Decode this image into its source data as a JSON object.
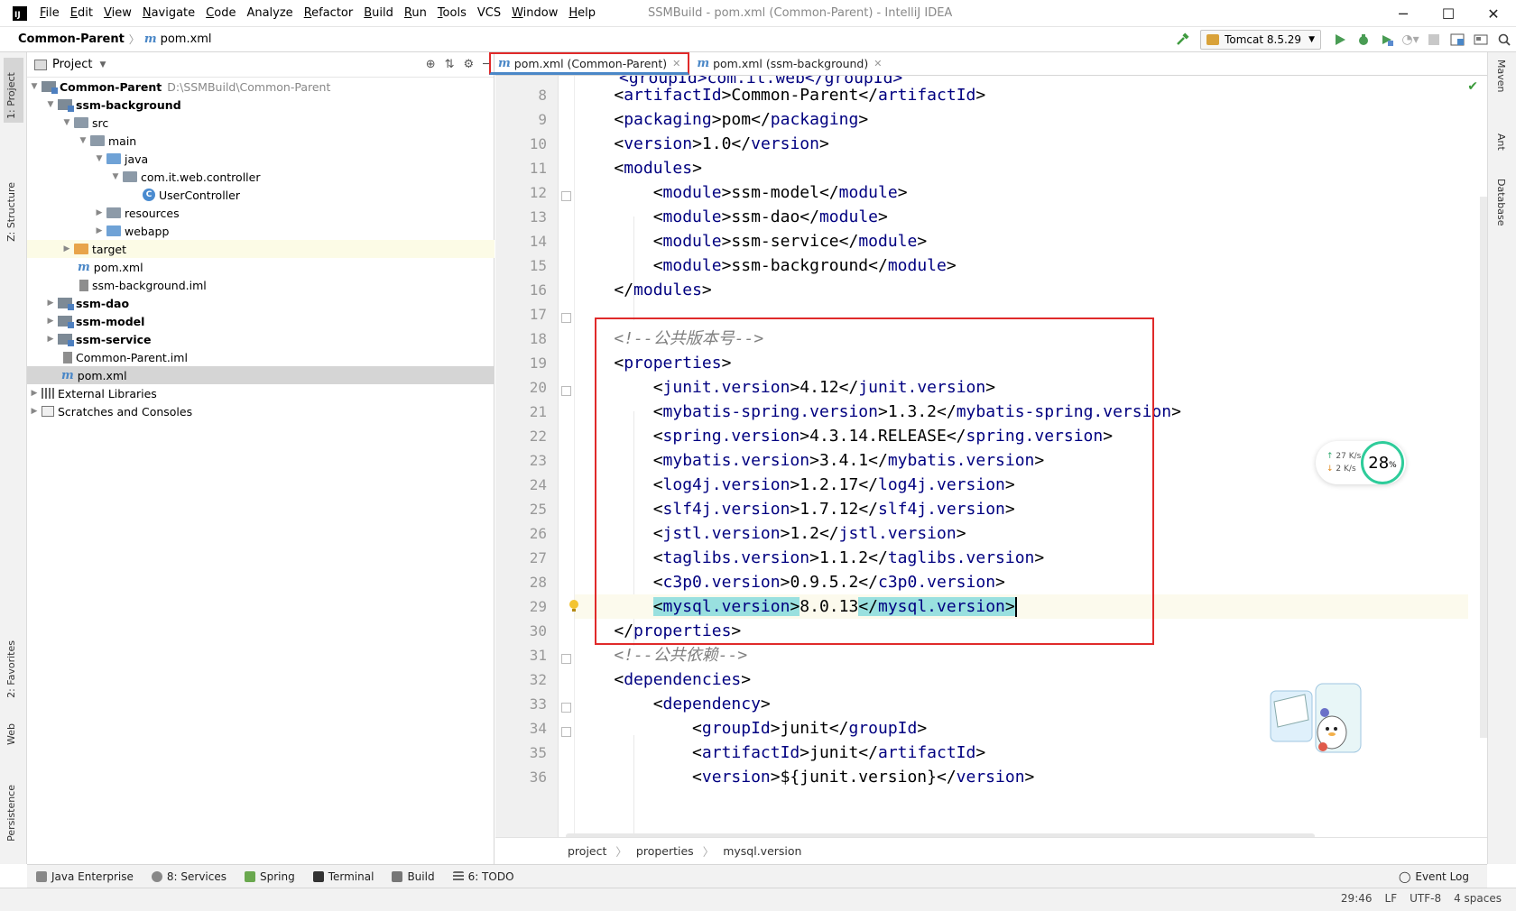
{
  "app": {
    "logo": "IJ",
    "menu": [
      {
        "mn": "F",
        "rest": "ile"
      },
      {
        "mn": "E",
        "rest": "dit"
      },
      {
        "mn": "V",
        "rest": "iew"
      },
      {
        "mn": "N",
        "rest": "avigate"
      },
      {
        "mn": "C",
        "rest": "ode"
      },
      {
        "mn": "",
        "rest": "Analyze"
      },
      {
        "mn": "R",
        "rest": "efactor"
      },
      {
        "mn": "B",
        "rest": "uild"
      },
      {
        "mn": "R",
        "rest": "un"
      },
      {
        "mn": "T",
        "rest": "ools"
      },
      {
        "mn": "",
        "rest": "VCS"
      },
      {
        "mn": "W",
        "rest": "indow"
      },
      {
        "mn": "H",
        "rest": "elp"
      }
    ],
    "window_title": "SSMBuild - pom.xml (Common-Parent) - IntelliJ IDEA",
    "win_controls": [
      "─",
      "☐",
      "✕"
    ]
  },
  "navbar": {
    "project": "Common-Parent",
    "file": "pom.xml",
    "run_config": "Tomcat 8.5.29"
  },
  "left_stripe": {
    "project": "1: Project",
    "structure": "Z: Structure",
    "favorites": "2: Favorites",
    "web": "Web",
    "persistence": "Persistence"
  },
  "right_stripe": {
    "maven": "Maven",
    "ant": "Ant",
    "database": "Database"
  },
  "project_panel": {
    "title": "Project",
    "tree": [
      {
        "label": "Common-Parent",
        "extra": "D:\\SSMBuild\\Common-Parent",
        "bold": true
      },
      {
        "label": "ssm-background",
        "bold": true
      },
      {
        "label": "src"
      },
      {
        "label": "main"
      },
      {
        "label": "java"
      },
      {
        "label": "com.it.web.controller"
      },
      {
        "label": "UserController"
      },
      {
        "label": "resources"
      },
      {
        "label": "webapp"
      },
      {
        "label": "target"
      },
      {
        "label": "pom.xml"
      },
      {
        "label": "ssm-background.iml"
      },
      {
        "label": "ssm-dao",
        "bold": true
      },
      {
        "label": "ssm-model",
        "bold": true
      },
      {
        "label": "ssm-service",
        "bold": true
      },
      {
        "label": "Common-Parent.iml"
      },
      {
        "label": "pom.xml"
      },
      {
        "label": "External Libraries"
      },
      {
        "label": "Scratches and Consoles"
      }
    ]
  },
  "editor": {
    "tabs": [
      {
        "label": "pom.xml (Common-Parent)",
        "active": true
      },
      {
        "label": "pom.xml (ssm-background)",
        "active": false
      }
    ],
    "line_numbers": [
      "8",
      "9",
      "10",
      "11",
      "12",
      "13",
      "14",
      "15",
      "16",
      "17",
      "18",
      "19",
      "20",
      "21",
      "22",
      "23",
      "24",
      "25",
      "26",
      "27",
      "28",
      "29",
      "30",
      "31",
      "32",
      "33",
      "34",
      "35",
      "36"
    ],
    "partial_top_line": "<groupId>com.it.web</groupId>",
    "comment_version": "<!--公共版本号-->",
    "comment_deps": "<!--公共依赖-->",
    "artifact": {
      "tag": "artifactId",
      "value": "Common-Parent"
    },
    "packaging": {
      "tag": "packaging",
      "value": "pom"
    },
    "version": {
      "tag": "version",
      "value": "1.0"
    },
    "modules_tag": "modules",
    "module_tag": "module",
    "modules": [
      "ssm-model",
      "ssm-dao",
      "ssm-service",
      "ssm-background"
    ],
    "properties_tag": "properties",
    "properties": [
      {
        "tag": "junit.version",
        "value": "4.12"
      },
      {
        "tag": "mybatis-spring.version",
        "value": "1.3.2"
      },
      {
        "tag": "spring.version",
        "value": "4.3.14.RELEASE"
      },
      {
        "tag": "mybatis.version",
        "value": "3.4.1"
      },
      {
        "tag": "log4j.version",
        "value": "1.2.17"
      },
      {
        "tag": "slf4j.version",
        "value": "1.7.12"
      },
      {
        "tag": "jstl.version",
        "value": "1.2"
      },
      {
        "tag": "taglibs.version",
        "value": "1.1.2"
      },
      {
        "tag": "c3p0.version",
        "value": "0.9.5.2"
      },
      {
        "tag": "mysql.version",
        "value": "8.0.13"
      }
    ],
    "dependencies_tag": "dependencies",
    "dependency_tag": "dependency",
    "dep_group": {
      "tag": "groupId",
      "value": "junit"
    },
    "dep_artifact": {
      "tag": "artifactId",
      "value": "junit"
    },
    "dep_version": {
      "tag": "version",
      "value": "${junit.version}"
    },
    "breadcrumbs": [
      "project",
      "properties",
      "mysql.version"
    ]
  },
  "net_widget": {
    "up": "27 K/s",
    "down": "2  K/s",
    "percent": "28",
    "percent_unit": "%"
  },
  "bottom_tabs": [
    "Java Enterprise",
    "8: Services",
    "Spring",
    "Terminal",
    "Build",
    "6: TODO"
  ],
  "event_log": "Event Log",
  "status": {
    "position": "29:46",
    "line_sep": "LF",
    "encoding": "UTF-8",
    "indent": "4 spaces"
  },
  "colors": {
    "tag": "#000080",
    "comment": "#808080",
    "highlight_box": "#e02a2a",
    "matched_tag_bg": "#99e0df"
  }
}
